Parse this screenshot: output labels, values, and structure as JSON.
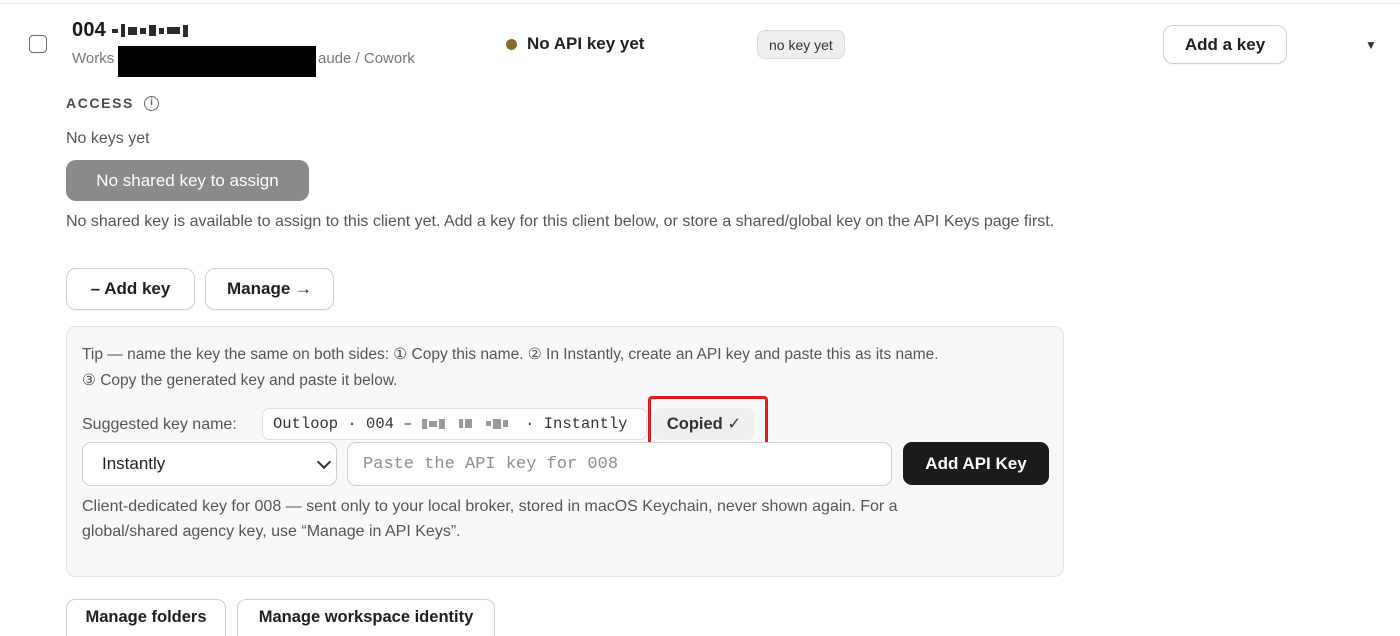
{
  "client": {
    "title": "004",
    "subtitle_start": "Works",
    "subtitle_end": "aude / Cowork",
    "status_text": "No API key yet",
    "status_dot_color": "#8a6a2b",
    "badge": "no key yet",
    "add_key_button": "Add a key",
    "expand_icon": "▼"
  },
  "access": {
    "label": "ACCESS",
    "info_icon": "i",
    "empty_text": "No keys yet",
    "no_shared_button": "No shared key to assign",
    "explanation": "No shared key is available to assign to this client yet. Add a key for this client below, or store a shared/global key on the API Keys page first."
  },
  "actions": {
    "add_key": "– Add key",
    "manage": "Manage →"
  },
  "panel": {
    "tip_line1": "Tip — name the key the same on both sides: ① Copy this name. ② In Instantly, create an API key and paste this as its name.",
    "tip_line2": "③ Copy the generated key and paste it below.",
    "suggested_label": "Suggested key name:",
    "suggested_prefix": "Outloop · 004 –",
    "suggested_suffix": "· Instantly",
    "copied_button": "Copied ✓",
    "provider_select": "Instantly",
    "key_placeholder": "Paste the API key for 008",
    "add_api_key_button": "Add API Key",
    "note_line1": "Client-dedicated key for 008 — sent only to your local broker, stored in macOS Keychain, never shown again. For a",
    "note_line2": "global/shared agency key, use “Manage in API Keys”."
  },
  "footer": {
    "manage_folders": "Manage folders",
    "manage_identity": "Manage workspace identity"
  }
}
